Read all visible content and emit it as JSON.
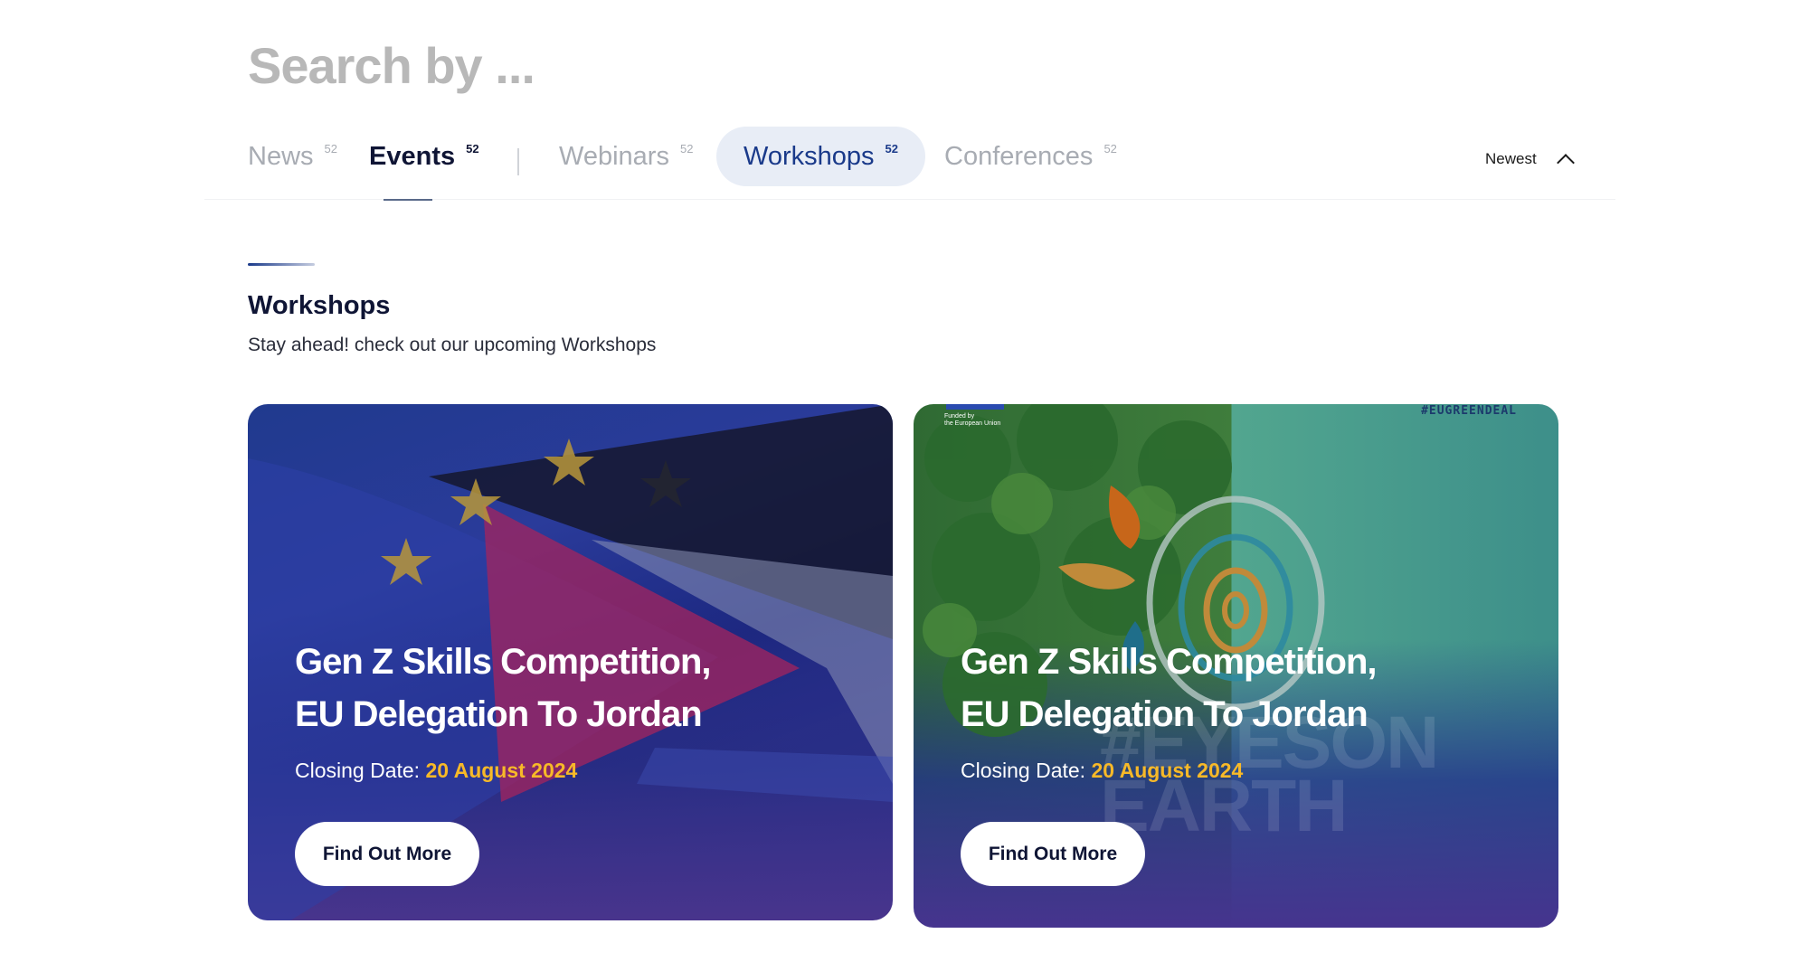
{
  "search": {
    "placeholder": "Search by ..."
  },
  "tabs": [
    {
      "label": "News",
      "count": "52"
    },
    {
      "label": "Events",
      "count": "52"
    },
    {
      "label": "Webinars",
      "count": "52"
    },
    {
      "label": "Workshops",
      "count": "52"
    },
    {
      "label": "Conferences",
      "count": "52"
    }
  ],
  "sort": {
    "label": "Newest",
    "icon": "chevron-up-icon"
  },
  "section": {
    "title": "Workshops",
    "subtitle": "Stay ahead! check out our upcoming Workshops"
  },
  "cards": [
    {
      "title_line1": "Gen Z Skills Competition,",
      "title_line2": "EU Delegation To Jordan",
      "date_label": "Closing Date:",
      "date_value": "20 August 2024",
      "button": "Find Out More"
    },
    {
      "title_line1": "Gen Z Skills Competition,",
      "title_line2": "EU Delegation To Jordan",
      "date_label": "Closing Date:",
      "date_value": "20 August 2024",
      "button": "Find Out More",
      "funded_line1": "Funded by",
      "funded_line2": "the European Union",
      "hashtag": "#EUGREENDEAL",
      "watermark_line1": "#EYESON",
      "watermark_line2": "EARTH"
    }
  ],
  "colors": {
    "accent": "#1a3a8a",
    "date_highlight": "#f7b928",
    "pill_bg": "#e8edf6"
  }
}
